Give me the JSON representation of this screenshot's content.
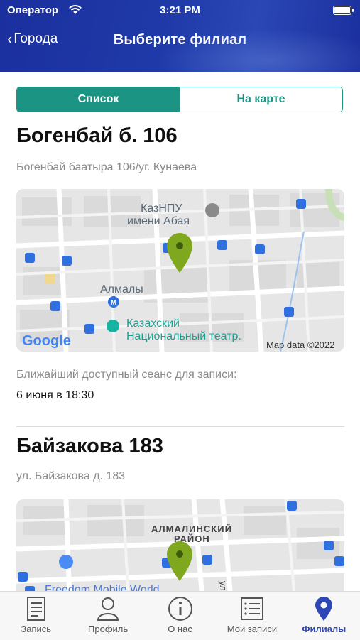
{
  "status_bar": {
    "carrier": "Оператор",
    "time": "3:21 PM"
  },
  "nav": {
    "back_label": "Города",
    "title": "Выберите филиал"
  },
  "segment": {
    "list_label": "Список",
    "map_label": "На карте",
    "selected": "list"
  },
  "branches": [
    {
      "title": "Богенбай б. 106",
      "address": "Богенбай баатыра 106/уг. Кунаева",
      "map": {
        "labels": [
          "КазНПУ",
          "имени Абая",
          "Алмалы",
          "Казахский",
          "Национальный театр."
        ],
        "google": "Google",
        "attribution": "Map data ©2022",
        "pin_color": "#7fa81f"
      },
      "nearest_label": "Ближайший доступный сеанс для записи:",
      "nearest_value": "6 июня в 18:30"
    },
    {
      "title": "Байзакова 183",
      "address": "ул. Байзакова д. 183",
      "map": {
        "labels": [
          "АЛМАЛИНСКИЙ",
          "РАЙОН",
          "Freedom Mobile World",
          "ул. М"
        ],
        "pin_color": "#7fa81f"
      }
    }
  ],
  "tabbar": {
    "items": [
      {
        "label": "Запись",
        "icon": "document-icon"
      },
      {
        "label": "Профиль",
        "icon": "profile-icon"
      },
      {
        "label": "О нас",
        "icon": "info-icon"
      },
      {
        "label": "Мои записи",
        "icon": "list-icon"
      },
      {
        "label": "Филиалы",
        "icon": "map-pin-icon"
      }
    ],
    "active_index": 4,
    "active_color": "#2f47b4"
  },
  "colors": {
    "header": "#1f3aa8",
    "accent": "#1b9484"
  }
}
